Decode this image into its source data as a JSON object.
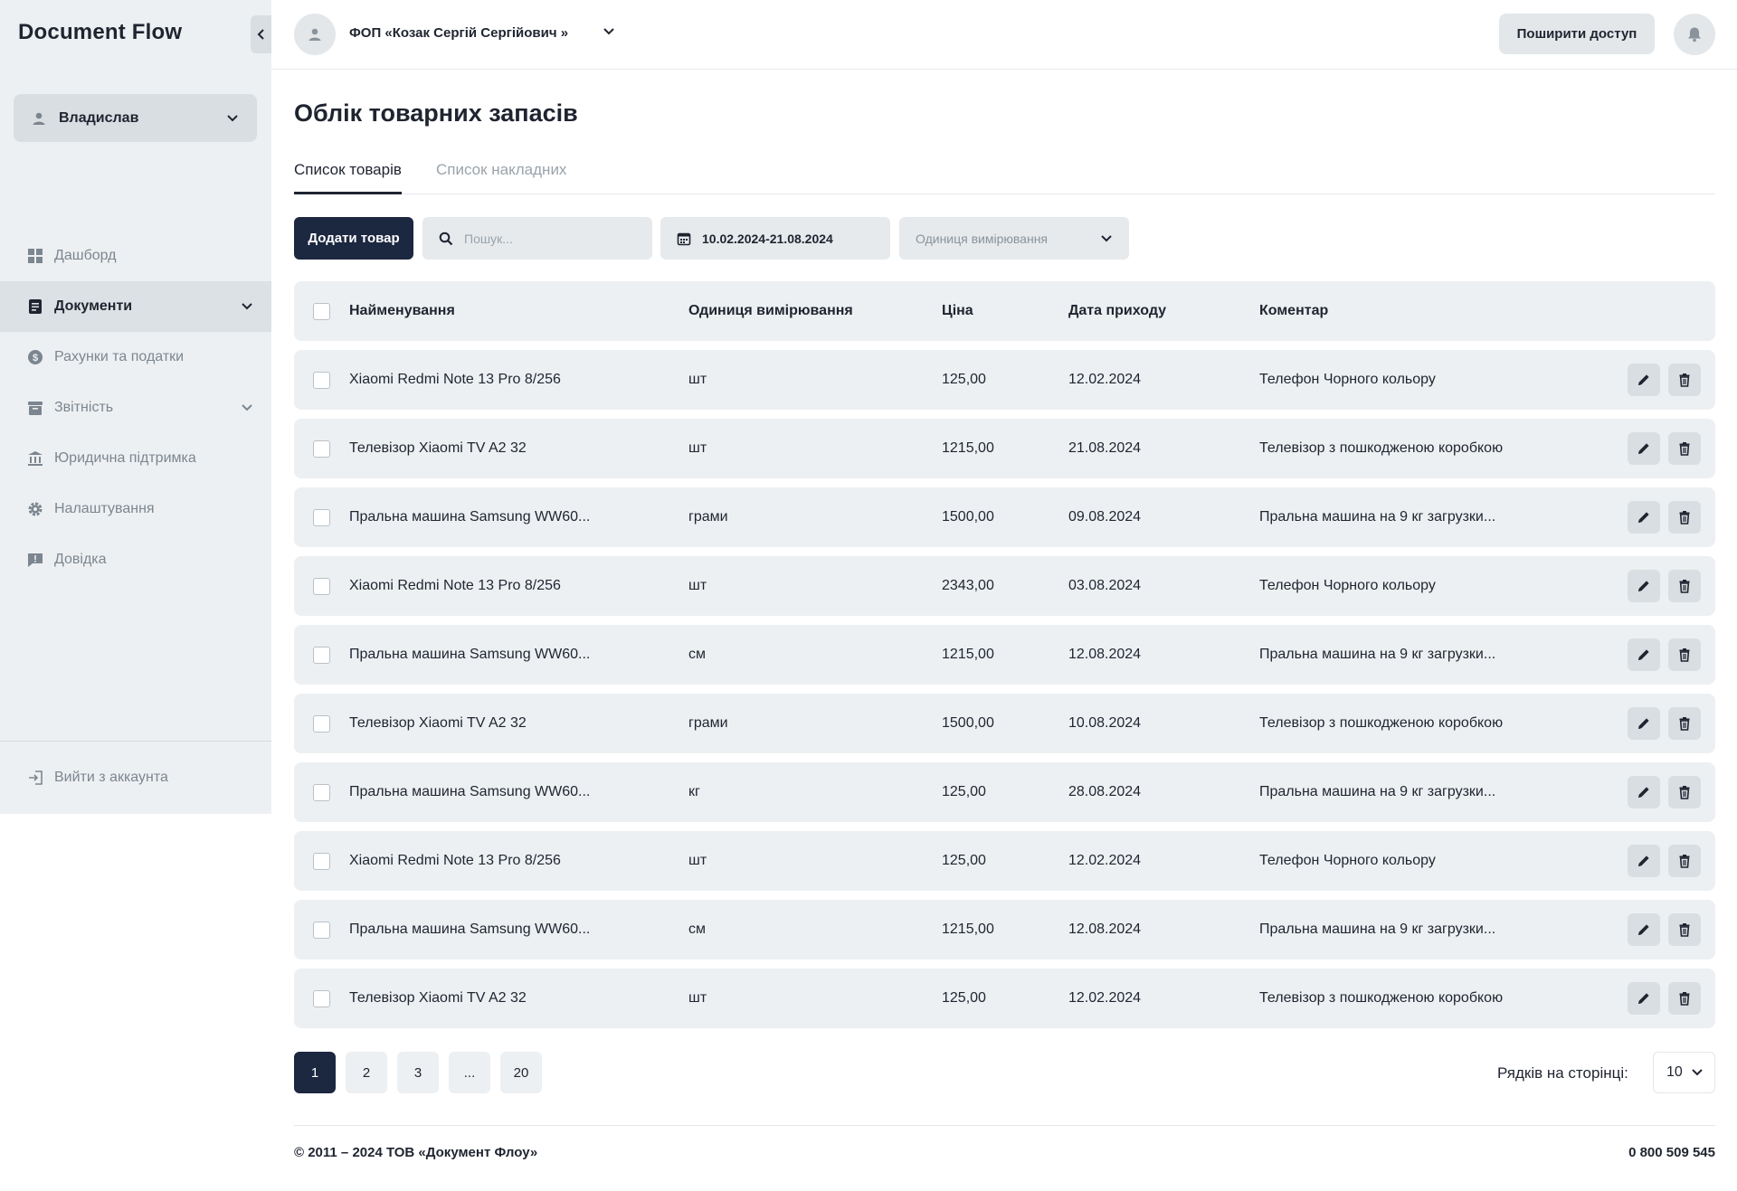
{
  "app": {
    "logo": "Document Flow"
  },
  "sidebar": {
    "user": "Владислав",
    "items": [
      {
        "label": "Дашборд",
        "icon": "dashboard-icon"
      },
      {
        "label": "Документи",
        "icon": "document-icon",
        "active": true
      },
      {
        "label": "Рахунки та податки",
        "icon": "dollar-icon"
      },
      {
        "label": "Звітність",
        "icon": "archive-icon"
      },
      {
        "label": "Юридична підтримка",
        "icon": "bank-icon"
      },
      {
        "label": "Налаштування",
        "icon": "gear-icon"
      },
      {
        "label": "Довідка",
        "icon": "help-icon"
      }
    ],
    "logout": "Вийти з аккаунта"
  },
  "header": {
    "org": "ФОП «Козак Сергій Сергійович »",
    "share": "Поширити доступ"
  },
  "page": {
    "title": "Облік товарних запасів",
    "tabs": [
      "Список товарів",
      "Список накладних"
    ]
  },
  "toolbar": {
    "add": "Додати товар",
    "search_placeholder": "Пошук...",
    "date_range": "10.02.2024-21.08.2024",
    "unit_placeholder": "Одиниця вимірювання"
  },
  "table": {
    "columns": [
      "Найменування",
      "Одиниця вимірювання",
      "Ціна",
      "Дата приходу",
      "Коментар"
    ],
    "rows": [
      {
        "name": "Xiaomi Redmi Note 13 Pro 8/256",
        "unit": "шт",
        "price": "125,00",
        "date": "12.02.2024",
        "comment": "Телефон Чорного кольору"
      },
      {
        "name": "Телевізор Xiaomi TV A2 32",
        "unit": "шт",
        "price": "1215,00",
        "date": "21.08.2024",
        "comment": "Телевізор з пошкодженою коробкою"
      },
      {
        "name": "Пральна машина Samsung WW60...",
        "unit": "грами",
        "price": "1500,00",
        "date": "09.08.2024",
        "comment": "Пральна машина на 9 кг загрузки..."
      },
      {
        "name": "Xiaomi Redmi Note 13 Pro 8/256",
        "unit": "шт",
        "price": "2343,00",
        "date": "03.08.2024",
        "comment": "Телефон Чорного кольору"
      },
      {
        "name": "Пральна машина Samsung WW60...",
        "unit": "см",
        "price": "1215,00",
        "date": "12.08.2024",
        "comment": "Пральна машина на 9 кг загрузки..."
      },
      {
        "name": "Телевізор Xiaomi TV A2 32",
        "unit": "грами",
        "price": "1500,00",
        "date": "10.08.2024",
        "comment": "Телевізор з пошкодженою коробкою"
      },
      {
        "name": "Пральна машина Samsung WW60...",
        "unit": "кг",
        "price": "125,00",
        "date": "28.08.2024",
        "comment": "Пральна машина на 9 кг загрузки..."
      },
      {
        "name": "Xiaomi Redmi Note 13 Pro 8/256",
        "unit": "шт",
        "price": "125,00",
        "date": "12.02.2024",
        "comment": "Телефон Чорного кольору"
      },
      {
        "name": "Пральна машина Samsung WW60...",
        "unit": "см",
        "price": "1215,00",
        "date": "12.08.2024",
        "comment": "Пральна машина на 9 кг загрузки..."
      },
      {
        "name": "Телевізор Xiaomi TV A2 32",
        "unit": "шт",
        "price": "125,00",
        "date": "12.02.2024",
        "comment": "Телевізор з пошкодженою коробкою"
      }
    ]
  },
  "pagination": {
    "pages": [
      "1",
      "2",
      "3",
      "...",
      "20"
    ],
    "current": "1",
    "rows_label": "Рядків на сторінці:",
    "rows_value": "10"
  },
  "footer": {
    "copyright": "© 2011 – 2024 ТОВ «Документ Флоу»",
    "phone": "0 800 509 545"
  },
  "colors": {
    "primary": "#1c2740",
    "surface": "#edf0f2",
    "muted": "#7c8690"
  }
}
